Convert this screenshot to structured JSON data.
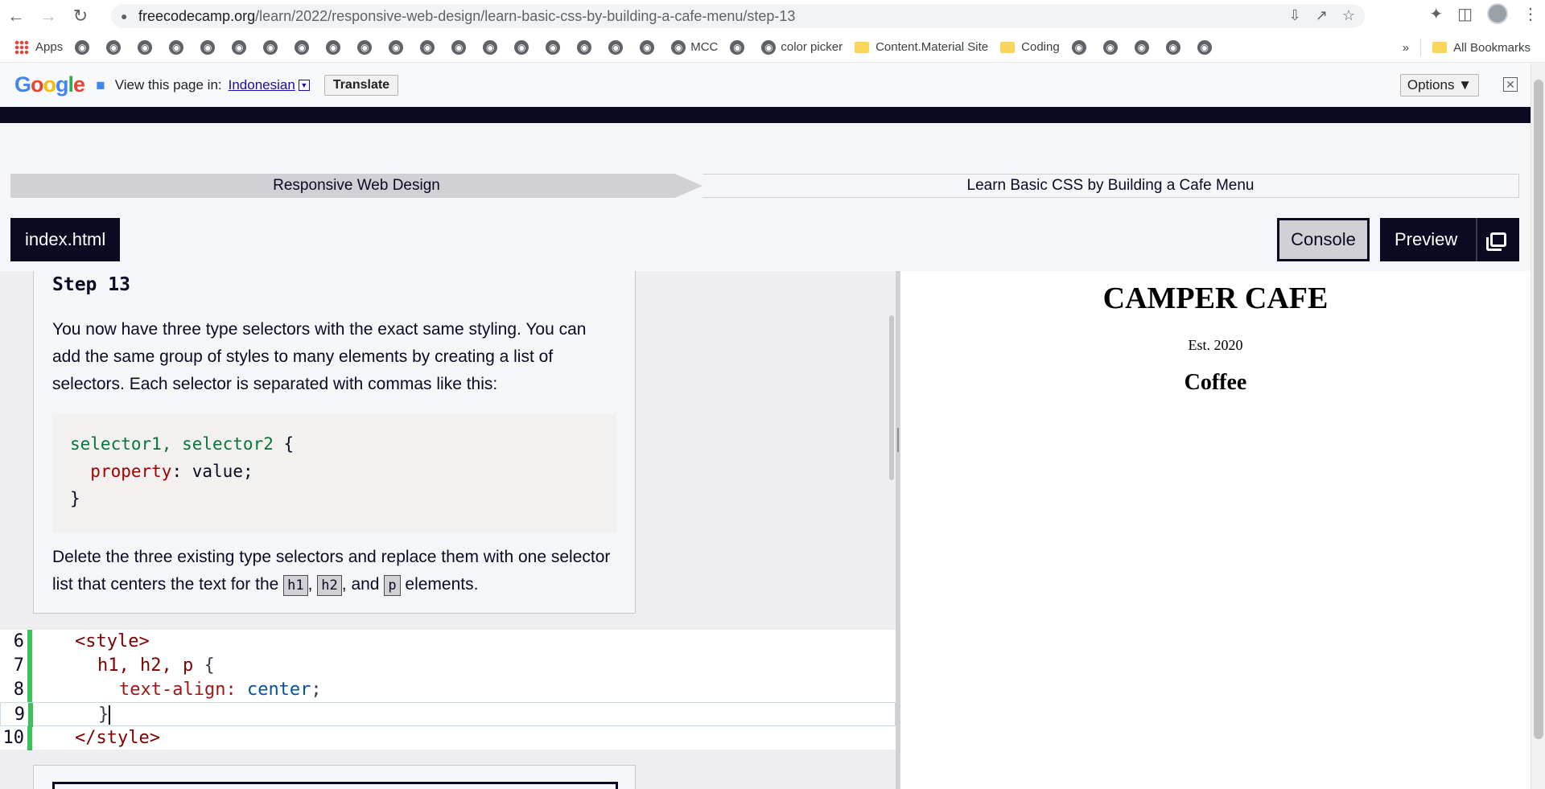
{
  "browser": {
    "url_host": "freecodecamp.org",
    "url_path": "/learn/2022/responsive-web-design/learn-basic-css-by-building-a-cafe-menu/step-13"
  },
  "bookmarks": {
    "apps": "Apps",
    "mcc": "MCC",
    "color_picker": "color picker",
    "content_material": "Content.Material Site",
    "coding": "Coding",
    "more": "»",
    "all": "All Bookmarks"
  },
  "translate": {
    "prompt": "View this page in:",
    "language": "Indonesian",
    "translate_btn": "Translate",
    "options_btn": "Options ▼"
  },
  "breadcrumb": {
    "superblock": "Responsive Web Design",
    "block": "Learn Basic CSS by Building a Cafe Menu"
  },
  "tabs": {
    "file": "index.html",
    "console": "Console",
    "preview": "Preview"
  },
  "lesson": {
    "step_title": "Step 13",
    "para1": "You now have three type selectors with the exact same styling. You can add the same group of styles to many elements by creating a list of selectors. Each selector is separated with commas like this:",
    "code_sel": "selector1, selector2",
    "code_open": " {",
    "code_prop": "property",
    "code_colon": ": ",
    "code_val": "value;",
    "code_close": "}",
    "para2_a": "Delete the three existing type selectors and replace them with one selector list that centers the text for the ",
    "kbd1": "h1",
    "sep1": ", ",
    "kbd2": "h2",
    "sep2": ", and ",
    "kbd3": "p",
    "para2_b": " elements."
  },
  "editor": {
    "lines": [
      {
        "num": "6"
      },
      {
        "num": "7"
      },
      {
        "num": "8"
      },
      {
        "num": "9"
      },
      {
        "num": "10"
      }
    ],
    "l6": "<style>",
    "l7_sel": "h1, h2, p",
    "l7_br": " {",
    "l8_prop": "text-align:",
    "l8_val": " center",
    "l8_end": ";",
    "l9": "}",
    "l10": "</style>"
  },
  "preview": {
    "h1": "CAMPER CAFE",
    "est": "Est. 2020",
    "h2": "Coffee"
  }
}
